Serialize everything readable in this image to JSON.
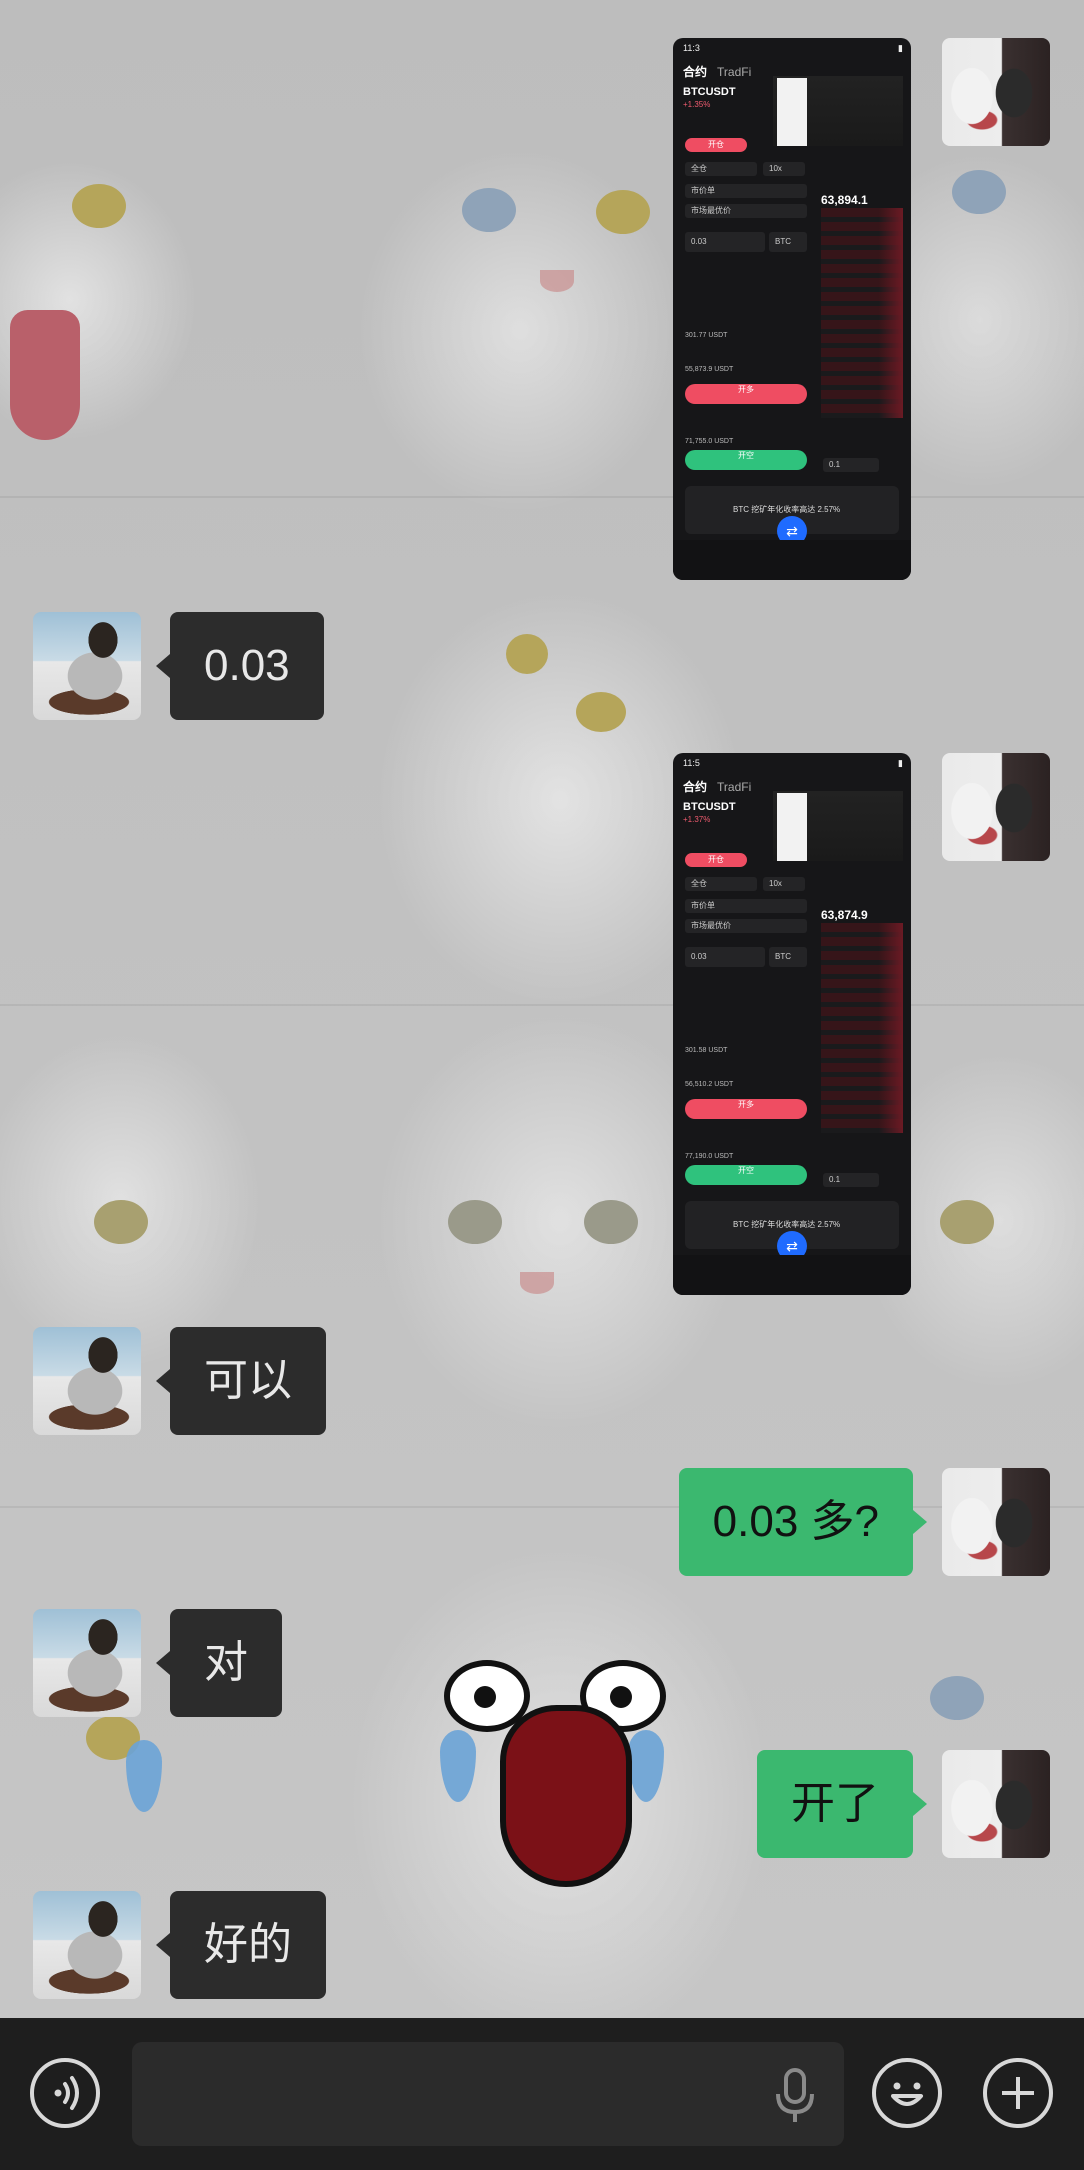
{
  "messages": [
    {
      "side": "out",
      "type": "image",
      "avatar": "her-avatar"
    },
    {
      "side": "in",
      "type": "text",
      "text": "0.03",
      "avatar": "his-avatar"
    },
    {
      "side": "out",
      "type": "image",
      "avatar": "her-avatar"
    },
    {
      "side": "in",
      "type": "text",
      "text": "可以",
      "avatar": "his-avatar"
    },
    {
      "side": "out",
      "type": "text",
      "text": "0.03 多?",
      "avatar": "her-avatar"
    },
    {
      "side": "in",
      "type": "text",
      "text": "对",
      "avatar": "his-avatar"
    },
    {
      "side": "out",
      "type": "text",
      "text": "开了",
      "avatar": "her-avatar"
    },
    {
      "side": "in",
      "type": "text",
      "text": "好的",
      "avatar": "his-avatar"
    }
  ],
  "screenshot1": {
    "status_time": "11:3",
    "tab_contract": "合约",
    "tab_tradfi": "TradFi",
    "pair": "BTCUSDT",
    "change": "+1.35%",
    "open_tab": "开仓",
    "margin_mode": "全仓",
    "leverage": "10x",
    "order_type": "市价单",
    "price_field": "市场最优价",
    "qty": "0.03",
    "qty_unit": "BTC",
    "last_price": "63,894.1",
    "available": "301.77 USDT",
    "liq_price": "55,873.9 USDT",
    "open_long": "开多",
    "liq_price_short": "71,755.0 USDT",
    "open_short": "开空",
    "banner": "BTC 挖矿年化收率高达 2.57%",
    "depth_step": "0.1"
  },
  "screenshot2": {
    "status_time": "11:5",
    "tab_contract": "合约",
    "tab_tradfi": "TradFi",
    "pair": "BTCUSDT",
    "change": "+1.37%",
    "open_tab": "开仓",
    "margin_mode": "全仓",
    "leverage": "10x",
    "order_type": "市价单",
    "price_field": "市场最优价",
    "qty": "0.03",
    "qty_unit": "BTC",
    "last_price": "63,874.9",
    "available": "301.58 USDT",
    "liq_price": "56,510.2 USDT",
    "open_long": "开多",
    "liq_price_short": "77,190.0 USDT",
    "open_short": "开空",
    "banner": "BTC 挖矿年化收率高达 2.57%",
    "depth_step": "0.1"
  },
  "input_bar": {
    "voice_toggle_icon": "voice-wave-icon",
    "mic_icon": "microphone-icon",
    "emoji_icon": "emoji-face-icon",
    "plus_icon": "plus-icon",
    "input_value": ""
  },
  "colors": {
    "out_bubble": "#3bb86f",
    "in_bubble": "#2c2c2c",
    "input_bar": "#1e1e1e"
  }
}
